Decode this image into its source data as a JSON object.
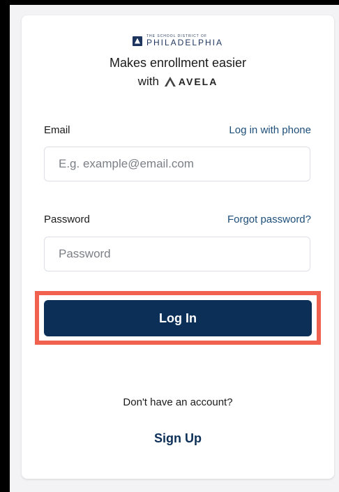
{
  "brand": {
    "small_text": "THE SCHOOL DISTRICT OF",
    "name": "PHILADELPHIA",
    "icon": "district-logo-icon"
  },
  "tagline": {
    "line1": "Makes enrollment easier",
    "with": "with",
    "partner": "AVELA",
    "partner_icon": "avela-logo-icon"
  },
  "email": {
    "label": "Email",
    "alt_link": "Log in with phone",
    "placeholder": "E.g. example@email.com",
    "value": ""
  },
  "password": {
    "label": "Password",
    "alt_link": "Forgot password?",
    "placeholder": "Password",
    "value": ""
  },
  "login_button": {
    "label": "Log In",
    "color": "#0c2f57",
    "highlight_color": "#f0614f"
  },
  "signup": {
    "prompt": "Don't have an account?",
    "label": "Sign Up"
  }
}
